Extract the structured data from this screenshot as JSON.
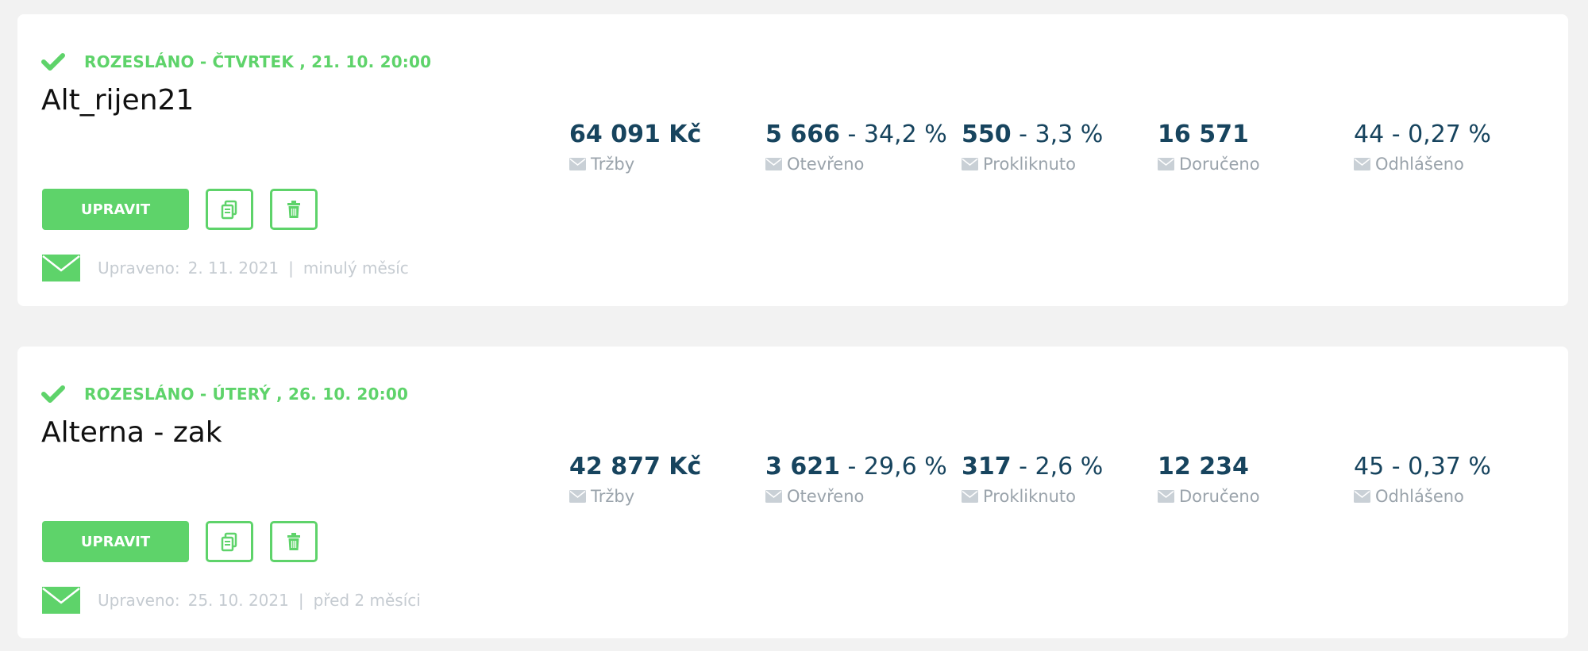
{
  "campaigns": [
    {
      "status": "ROZESLÁNO - ČTVRTEK , 21. 10. 20:00",
      "name": "Alt_rijen21",
      "edit_label": "UPRAVIT",
      "modified_label": "Upraveno:",
      "modified_date": "2. 11. 2021",
      "separator": "|",
      "modified_relative": "minulý měsíc",
      "stats": {
        "revenue": {
          "value": "64 091 Kč",
          "label": "Tržby"
        },
        "opened": {
          "count": "5 666",
          "percent": "- 34,2 %",
          "label": "Otevřeno"
        },
        "clicked": {
          "count": "550",
          "percent": "- 3,3 %",
          "label": "Prokliknuto"
        },
        "delivered": {
          "value": "16 571",
          "label": "Doručeno"
        },
        "unsubscribed": {
          "value": "44 - 0,27 %",
          "label": "Odhlášeno"
        }
      }
    },
    {
      "status": "ROZESLÁNO - ÚTERÝ , 26. 10. 20:00",
      "name": "Alterna - zak",
      "edit_label": "UPRAVIT",
      "modified_label": "Upraveno:",
      "modified_date": "25. 10. 2021",
      "separator": "|",
      "modified_relative": "před 2 měsíci",
      "stats": {
        "revenue": {
          "value": "42 877 Kč",
          "label": "Tržby"
        },
        "opened": {
          "count": "3 621",
          "percent": "- 29,6 %",
          "label": "Otevřeno"
        },
        "clicked": {
          "count": "317",
          "percent": "- 2,6 %",
          "label": "Prokliknuto"
        },
        "delivered": {
          "value": "12 234",
          "label": "Doručeno"
        },
        "unsubscribed": {
          "value": "45 - 0,37 %",
          "label": "Odhlášeno"
        }
      }
    }
  ],
  "icons": {
    "status": "check-icon",
    "copy": "copy-icon",
    "delete": "trash-icon",
    "email": "envelope-icon",
    "stat": "envelope-icon"
  },
  "colors": {
    "accent": "#5ed36a",
    "stat_text": "#17445e",
    "muted": "#9aa3ab",
    "background": "#f2f2f2"
  }
}
